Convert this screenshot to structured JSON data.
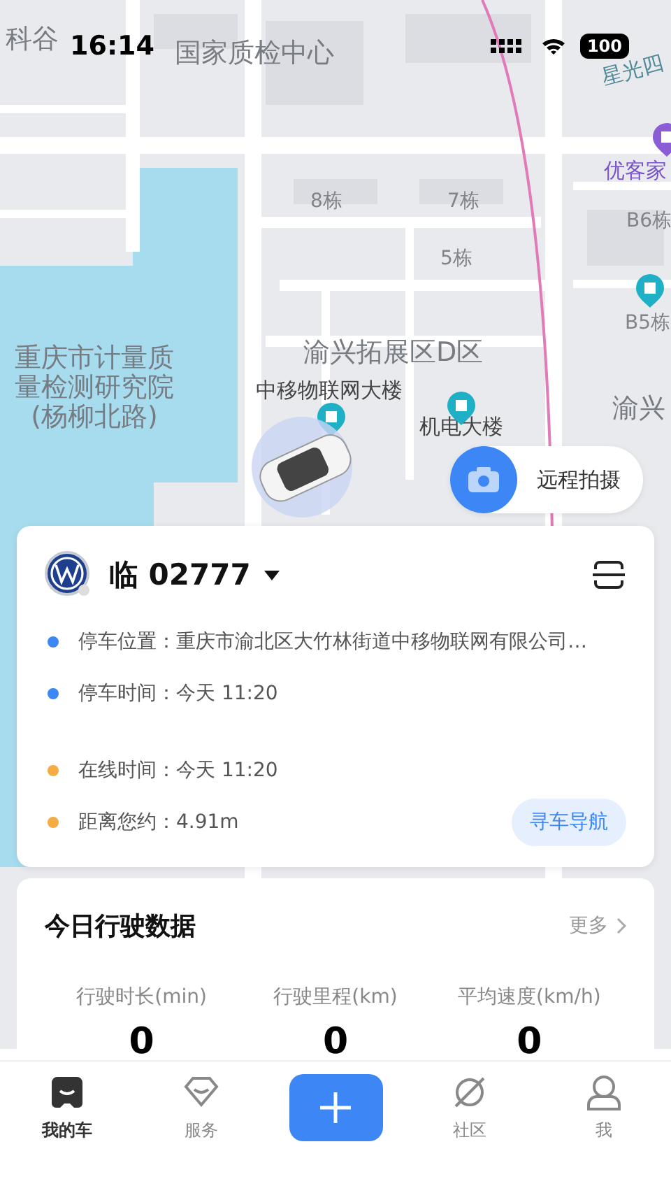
{
  "status_bar": {
    "time": "16:14",
    "battery": "100"
  },
  "map": {
    "labels": [
      {
        "text": "科谷",
        "kind": "area"
      },
      {
        "text": "国家质检中心",
        "kind": "area"
      },
      {
        "text": "星光四",
        "kind": "road"
      },
      {
        "text": "优客家",
        "kind": "poi"
      },
      {
        "text": "B6栋",
        "kind": "building"
      },
      {
        "text": "8栋",
        "kind": "building"
      },
      {
        "text": "7栋",
        "kind": "building"
      },
      {
        "text": "5栋",
        "kind": "building"
      },
      {
        "text": "B5栋",
        "kind": "building"
      },
      {
        "text": "重庆市计量质量检测研究院(杨柳北路)",
        "kind": "area"
      },
      {
        "text": "渝兴拓展区D区",
        "kind": "area"
      },
      {
        "text": "中移物联网大楼",
        "kind": "place"
      },
      {
        "text": "机电大楼",
        "kind": "place"
      },
      {
        "text": "渝兴",
        "kind": "area"
      }
    ]
  },
  "remote_photo": {
    "label": "远程拍摄"
  },
  "vehicle": {
    "plate": "临 02777",
    "items": [
      {
        "label": "停车位置：",
        "value": "重庆市渝北区大竹林街道中移物联网有限公司…",
        "color": "#3d86f5"
      },
      {
        "label": "停车时间：",
        "value": "今天 11:20",
        "color": "#3d86f5"
      },
      {
        "label": "在线时间：",
        "value": "今天 11:20",
        "color": "#f6ac45"
      },
      {
        "label": "距离您约：",
        "value": "4.91m",
        "color": "#f6ac45"
      }
    ],
    "navigate_button": "寻车导航"
  },
  "drive_data": {
    "title": "今日行驶数据",
    "more": "更多",
    "stats": [
      {
        "label": "行驶时长(min)",
        "value": "0"
      },
      {
        "label": "行驶里程(km)",
        "value": "0"
      },
      {
        "label": "平均速度(km/h)",
        "value": "0"
      }
    ]
  },
  "tabs": [
    {
      "kind": "tab",
      "label": "我的车",
      "selected": true
    },
    {
      "kind": "tab",
      "label": "服务",
      "selected": false
    },
    {
      "kind": "add"
    },
    {
      "kind": "tab",
      "label": "社区",
      "selected": false
    },
    {
      "kind": "tab",
      "label": "我",
      "selected": false
    }
  ]
}
